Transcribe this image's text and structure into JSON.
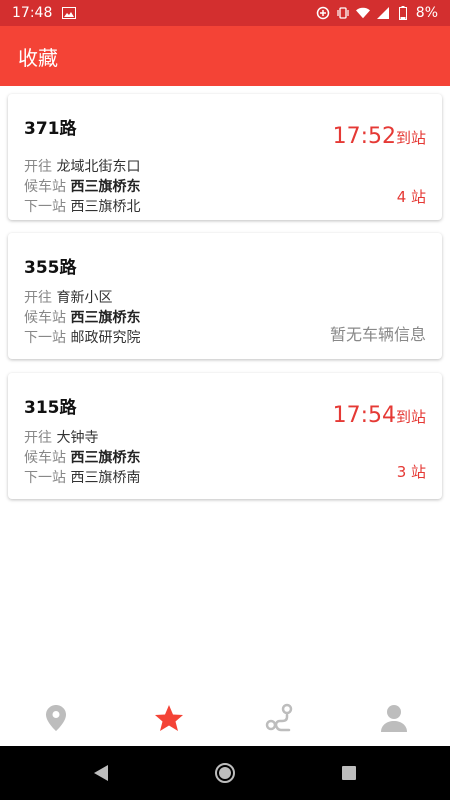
{
  "status": {
    "time": "17:48",
    "battery": "8%"
  },
  "header": {
    "title": "收藏"
  },
  "favorites": [
    {
      "route": "371路",
      "dir_label": "开往",
      "direction": "龙域北街东口",
      "wait_label": "候车站",
      "wait_station": "西三旗桥东",
      "next_label": "下一站",
      "next_station": "西三旗桥北",
      "arrival_time": "17:52",
      "arrival_unit": "到站",
      "stops": "4 站"
    },
    {
      "route": "355路",
      "dir_label": "开往",
      "direction": "育新小区",
      "wait_label": "候车站",
      "wait_station": "西三旗桥东",
      "next_label": "下一站",
      "next_station": "邮政研究院",
      "no_info": "暂无车辆信息"
    },
    {
      "route": "315路",
      "dir_label": "开往",
      "direction": "大钟寺",
      "wait_label": "候车站",
      "wait_station": "西三旗桥东",
      "next_label": "下一站",
      "next_station": "西三旗桥南",
      "arrival_time": "17:54",
      "arrival_unit": "到站",
      "stops": "3 站"
    }
  ],
  "nav": {
    "items": [
      {
        "icon": "location-pin-icon",
        "active": false
      },
      {
        "icon": "star-icon",
        "active": true
      },
      {
        "icon": "route-icon",
        "active": false
      },
      {
        "icon": "person-icon",
        "active": false
      }
    ],
    "active_color": "#f44336",
    "inactive_color": "#bdbdbd"
  },
  "colors": {
    "status_bar": "#d32f2f",
    "app_bar": "#f44336",
    "accent": "#e53935"
  }
}
